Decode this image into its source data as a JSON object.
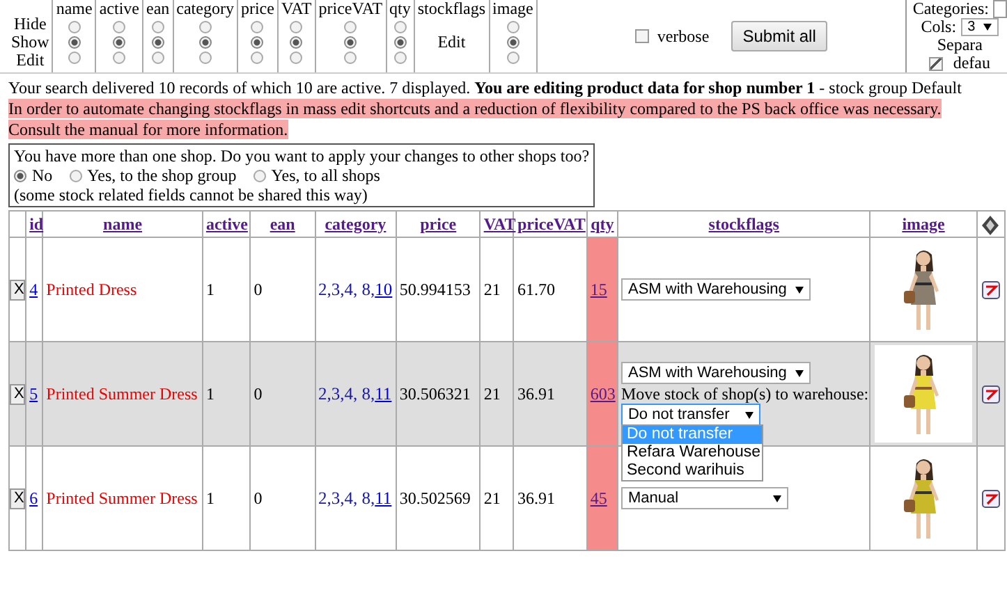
{
  "field_settings": {
    "row_labels": [
      "Hide",
      "Show",
      "Edit"
    ],
    "columns": [
      {
        "label": "name",
        "kind": "radios",
        "choices": [
          {
            "selected": false
          },
          {
            "selected": true
          },
          {
            "selected": false
          }
        ]
      },
      {
        "label": "active",
        "kind": "radios",
        "choices": [
          {
            "selected": false
          },
          {
            "selected": true
          },
          {
            "selected": false
          }
        ]
      },
      {
        "label": "ean",
        "kind": "radios",
        "choices": [
          {
            "selected": false
          },
          {
            "selected": true
          },
          {
            "selected": false
          }
        ]
      },
      {
        "label": "category",
        "kind": "radios",
        "choices": [
          {
            "selected": false
          },
          {
            "selected": true
          },
          {
            "selected": false
          }
        ]
      },
      {
        "label": "price",
        "kind": "radios",
        "choices": [
          {
            "selected": false
          },
          {
            "selected": true
          },
          {
            "selected": false
          }
        ]
      },
      {
        "label": "VAT",
        "kind": "radios",
        "choices": [
          {
            "selected": false
          },
          {
            "selected": true
          },
          {
            "selected": false
          }
        ]
      },
      {
        "label": "priceVAT",
        "kind": "radios",
        "choices": [
          {
            "selected": false
          },
          {
            "selected": true
          },
          {
            "selected": false
          }
        ]
      },
      {
        "label": "qty",
        "kind": "radios",
        "choices": [
          {
            "selected": false
          },
          {
            "selected": true
          },
          {
            "selected": false
          }
        ]
      },
      {
        "label": "stockflags",
        "kind": "text",
        "text": "Edit"
      },
      {
        "label": "image",
        "kind": "radios",
        "choices": [
          {
            "selected": false
          },
          {
            "selected": true
          },
          {
            "selected": false
          }
        ]
      }
    ]
  },
  "verbose": {
    "label": "verbose",
    "checked": false
  },
  "submit_button": "Submit all",
  "layout_panel": {
    "categories_label": "Categories:",
    "cols_label": "Cols:",
    "cols_value": "3",
    "separator_label": "Separa",
    "default": {
      "label": "defau",
      "checked": true
    }
  },
  "search_info": "Your search delivered 10 records of which 10 are active. 7 displayed. **You are editing product data for shop number 1** - stock group Default",
  "notice": [
    "In order to automate changing stockflags in mass edit shortcuts and a reduction of flexibility compared to the PS back office was necessary.",
    "Consult the manual for more information."
  ],
  "shop_share": {
    "question": "You have more than one shop. Do you want to apply your changes to other shops too?",
    "options": [
      {
        "label": "No",
        "selected": true
      },
      {
        "label": "Yes, to the shop group",
        "selected": false
      },
      {
        "label": "Yes, to all shops",
        "selected": false
      }
    ],
    "note": "(some stock related fields cannot be shared this way)"
  },
  "table": {
    "columns": [
      "id",
      "name",
      "active",
      "ean",
      "category",
      "price",
      "VAT",
      "priceVAT",
      "qty",
      "stockflags",
      "image"
    ],
    "rows": [
      {
        "button": "X",
        "id": "4",
        "name": "Printed Dress",
        "active": "1",
        "ean": "0",
        "category_text": "2,3,4, 8,",
        "category_link": "10",
        "price": "50.994153",
        "vat": "21",
        "price_vat": "61.70",
        "qty": "15",
        "stockflag": "ASM with Warehousing",
        "highlighted": false
      },
      {
        "button": "X",
        "id": "5",
        "name": "Printed Summer Dress",
        "active": "1",
        "ean": "0",
        "category_text": "2,3,4, 8,",
        "category_link": "11",
        "price": "30.506321",
        "vat": "21",
        "price_vat": "36.91",
        "qty": "603",
        "stockflag": "ASM with Warehousing",
        "highlighted": true,
        "transfer": {
          "label": "Move stock of shop(s) to warehouse:",
          "value": "Do not transfer",
          "expanded": true,
          "options": [
            {
              "label": "Do not transfer",
              "selected": true
            },
            {
              "label": "Refara Warehouse",
              "selected": false
            },
            {
              "label": "Second warihuis",
              "selected": false
            }
          ]
        }
      },
      {
        "button": "X",
        "id": "6",
        "name": "Printed Summer Dress",
        "active": "1",
        "ean": "0",
        "category_text": "2,3,4, 8,",
        "category_link": "11",
        "price": "30.502569",
        "vat": "21",
        "price_vat": "36.91",
        "qty": "45",
        "stockflag": "Manual",
        "highlighted": false
      }
    ]
  }
}
